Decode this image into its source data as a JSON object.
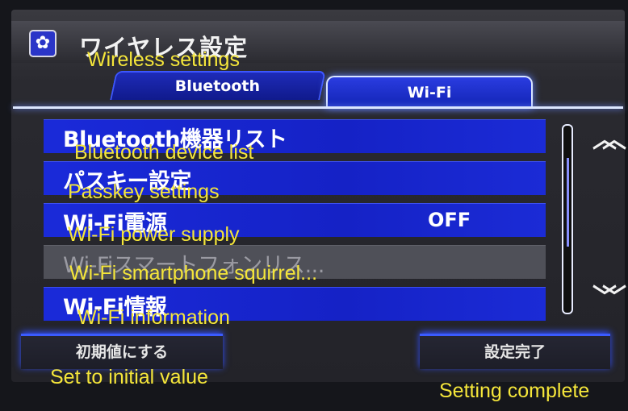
{
  "header": {
    "title": "ワイヤレス設定",
    "icon": "gear-icon",
    "title_annotation": "Wireless settings"
  },
  "tabs": [
    {
      "label": "Bluetooth",
      "active": false
    },
    {
      "label": "Wi-Fi",
      "active": true
    }
  ],
  "list": {
    "items": [
      {
        "label": "Bluetooth機器リスト",
        "annotation": "Bluetooth device list",
        "value": "",
        "enabled": true
      },
      {
        "label": "パスキー設定",
        "annotation": "Passkey settings",
        "value": "",
        "enabled": true
      },
      {
        "label": "Wi-Fi電源",
        "annotation": "Wi-Fi power supply",
        "value": "OFF",
        "enabled": true
      },
      {
        "label": "Wi-Fiスマートフォンリス...",
        "annotation": "Wi-Fi smartphone squirrel...",
        "value": "",
        "enabled": false
      },
      {
        "label": "Wi-Fi情報",
        "annotation": "Wi-Fi information",
        "value": "",
        "enabled": true
      }
    ]
  },
  "scroll": {
    "up_icon": "double-chevron-up-icon",
    "down_icon": "double-chevron-down-icon"
  },
  "footer": {
    "reset_label": "初期値にする",
    "reset_annotation": "Set to initial value",
    "done_label": "設定完了",
    "done_annotation": "Setting complete"
  },
  "colors": {
    "accent_blue": "#1a2ad9",
    "annotation_yellow": "#f5e63a",
    "disabled_gray": "#4f5058"
  }
}
